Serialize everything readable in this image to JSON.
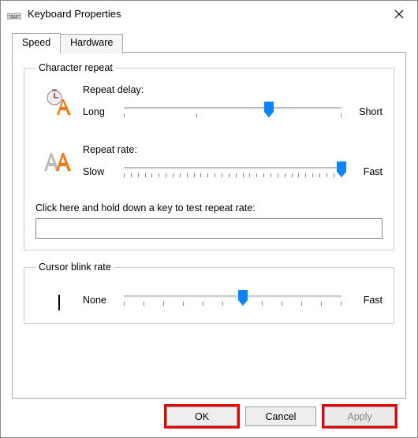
{
  "window": {
    "title": "Keyboard Properties"
  },
  "tabs": {
    "speed": "Speed",
    "hardware": "Hardware",
    "active": "speed"
  },
  "char_repeat": {
    "legend": "Character repeat",
    "delay": {
      "label": "Repeat delay:",
      "left": "Long",
      "right": "Short",
      "ticks": 4,
      "value_index": 2
    },
    "rate": {
      "label": "Repeat rate:",
      "left": "Slow",
      "right": "Fast",
      "ticks": 32,
      "value_index": 31
    },
    "test_label": "Click here and hold down a key to test repeat rate:",
    "test_value": ""
  },
  "cursor_blink": {
    "legend": "Cursor blink rate",
    "left": "None",
    "right": "Fast",
    "ticks": 12,
    "value_index": 6
  },
  "buttons": {
    "ok": "OK",
    "cancel": "Cancel",
    "apply": "Apply"
  },
  "colors": {
    "accent": "#0a84ff",
    "highlight": "#e60000"
  }
}
